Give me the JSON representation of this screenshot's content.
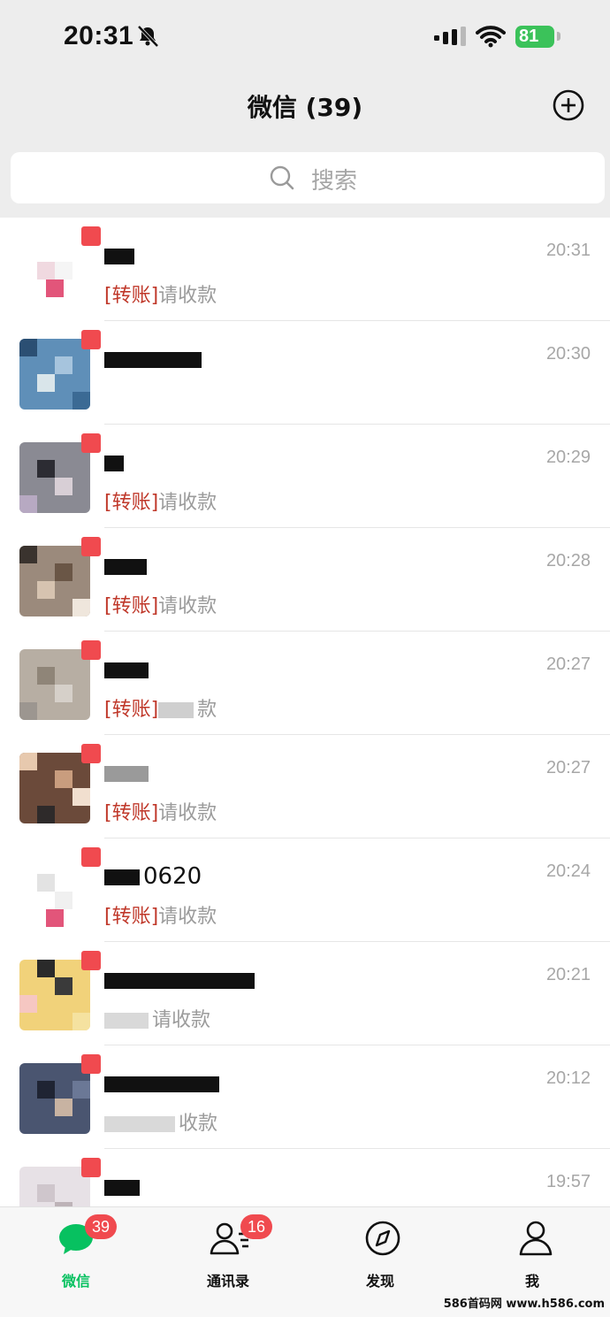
{
  "status_bar": {
    "time": "20:31",
    "battery": "81"
  },
  "header": {
    "title": "微信 (39)"
  },
  "search": {
    "placeholder": "搜索"
  },
  "chats": [
    {
      "name": "",
      "message_tag": "[转账]",
      "message": "请收款",
      "time": "20:31"
    },
    {
      "name": "",
      "message_tag": "",
      "message": "",
      "time": "20:30"
    },
    {
      "name": "",
      "message_tag": "[转账]",
      "message": "请收款",
      "time": "20:29"
    },
    {
      "name": "",
      "message_tag": "[转账]",
      "message": "请收款",
      "time": "20:28"
    },
    {
      "name": "",
      "message_tag": "[转账]",
      "message": "款",
      "time": "20:27"
    },
    {
      "name": "",
      "message_tag": "[转账]",
      "message": "请收款",
      "time": "20:27"
    },
    {
      "name": "0620",
      "message_tag": "[转账]",
      "message": "请收款",
      "time": "20:24"
    },
    {
      "name": "",
      "message_tag": "",
      "message": "请收款",
      "time": "20:21"
    },
    {
      "name": "",
      "message_tag": "",
      "message": "收款",
      "time": "20:12"
    },
    {
      "name": "",
      "message_tag": "",
      "message": "",
      "time": "19:57"
    }
  ],
  "tabs": [
    {
      "label": "微信",
      "badge": "39",
      "color": "#07c160",
      "icon": "chat-bubble-icon"
    },
    {
      "label": "通讯录",
      "badge": "16",
      "color": "#111111",
      "icon": "contacts-icon"
    },
    {
      "label": "发现",
      "badge": "",
      "color": "#111111",
      "icon": "compass-icon"
    },
    {
      "label": "我",
      "badge": "",
      "color": "#111111",
      "icon": "person-icon"
    }
  ],
  "watermark": "586首码网 www.h586.com"
}
